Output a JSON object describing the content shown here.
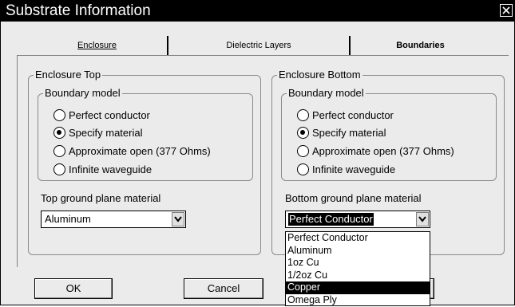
{
  "window": {
    "title": "Substrate Information",
    "close_icon": "close-x-icon"
  },
  "tabs": [
    {
      "label": "Enclosure",
      "selected": false
    },
    {
      "label": "Dielectric Layers",
      "selected": false
    },
    {
      "label": "Boundaries",
      "selected": true
    }
  ],
  "enclosure_top": {
    "group_label": "Enclosure Top",
    "boundary_model_label": "Boundary model",
    "options": [
      {
        "label": "Perfect conductor",
        "checked": false
      },
      {
        "label": "Specify material",
        "checked": true
      },
      {
        "label": "Approximate open (377 Ohms)",
        "checked": false
      },
      {
        "label": "Infinite waveguide",
        "checked": false
      }
    ],
    "ground_plane_label": "Top ground plane material",
    "ground_plane_value": "Aluminum"
  },
  "enclosure_bottom": {
    "group_label": "Enclosure Bottom",
    "boundary_model_label": "Boundary model",
    "options": [
      {
        "label": "Perfect conductor",
        "checked": false
      },
      {
        "label": "Specify material",
        "checked": true
      },
      {
        "label": "Approximate open (377 Ohms)",
        "checked": false
      },
      {
        "label": "Infinite waveguide",
        "checked": false
      }
    ],
    "ground_plane_label": "Bottom ground plane material",
    "ground_plane_value": "Perfect Conductor",
    "dropdown_options": [
      "Perfect Conductor",
      "Aluminum",
      "1oz Cu",
      "1/2oz Cu",
      "Copper",
      "Omega Ply"
    ],
    "dropdown_highlighted": "Copper"
  },
  "buttons": {
    "ok": "OK",
    "cancel": "Cancel"
  }
}
